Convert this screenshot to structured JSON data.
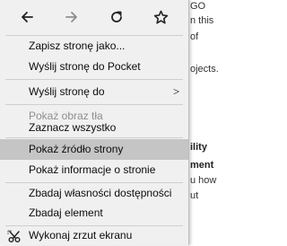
{
  "background_page": {
    "fragments": [
      "GO",
      "n this",
      "of",
      "ojects.",
      "ility",
      "ment",
      "u how",
      "ut"
    ]
  },
  "nav": {
    "back_icon": "arrow-left-icon",
    "forward_icon": "arrow-right-icon",
    "reload_icon": "reload-icon",
    "bookmark_icon": "star-outline-icon"
  },
  "menu": {
    "items": [
      {
        "label": "Zapisz stronę jako...",
        "disabled": false
      },
      {
        "label": "Wyślij stronę do Pocket",
        "disabled": false
      },
      {
        "label": "Wyślij stronę do",
        "disabled": false,
        "submenu": true
      },
      {
        "label": "Pokaż obraz tła",
        "disabled": true
      },
      {
        "label": "Zaznacz wszystko",
        "disabled": false
      },
      {
        "label": "Pokaż źródło strony",
        "disabled": false,
        "highlighted": true
      },
      {
        "label": "Pokaż informacje o stronie",
        "disabled": false
      },
      {
        "label": "Zbadaj własności dostępności",
        "disabled": false
      },
      {
        "label": "Zbadaj element",
        "disabled": false
      },
      {
        "label": "Wykonaj zrzut ekranu",
        "disabled": false,
        "icon": "screenshot-scissors-icon"
      }
    ],
    "submenu_arrow": ">"
  },
  "colors": {
    "menu_bg": "#f0f0f0",
    "highlight_bg": "#c5c5c5",
    "disabled_text": "#8f8f8f"
  }
}
